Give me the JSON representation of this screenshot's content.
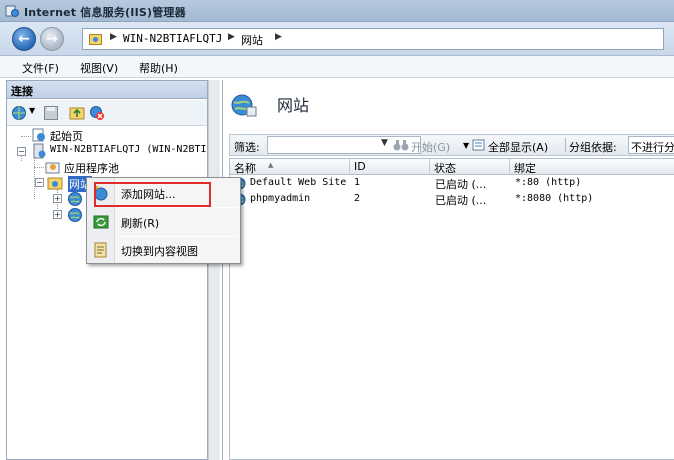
{
  "window": {
    "title": "Internet 信息服务(IIS)管理器"
  },
  "address": {
    "crumbs": [
      "WIN-N2BTIAFLQTJ",
      "网站"
    ],
    "separator": "▶"
  },
  "menu": {
    "items": [
      "文件(F)",
      "视图(V)",
      "帮助(H)"
    ]
  },
  "left": {
    "header": "连接",
    "tree": {
      "start_page": "起始页",
      "server": "WIN-N2BTIAFLQTJ (WIN-N2BTI",
      "app_pools": "应用程序池",
      "sites": "网站"
    }
  },
  "right": {
    "page_title": "网站",
    "filter": {
      "label": "筛选:",
      "start": "开始(G)",
      "show_all": "全部显示(A)",
      "group_by": "分组依据:",
      "group_value": "不进行分"
    },
    "columns": [
      "名称",
      "ID",
      "状态",
      "绑定"
    ],
    "rows": [
      {
        "name": "Default Web Site",
        "id": "1",
        "status": "已启动 (...",
        "binding": "*:80 (http)"
      },
      {
        "name": "phpmyadmin",
        "id": "2",
        "status": "已启动 (...",
        "binding": "*:8080 (http)"
      }
    ]
  },
  "context_menu": {
    "items": [
      "添加网站...",
      "刷新(R)",
      "切换到内容视图"
    ]
  },
  "colors": {
    "highlight": "#e12a2a",
    "selection": "#3169c6"
  }
}
